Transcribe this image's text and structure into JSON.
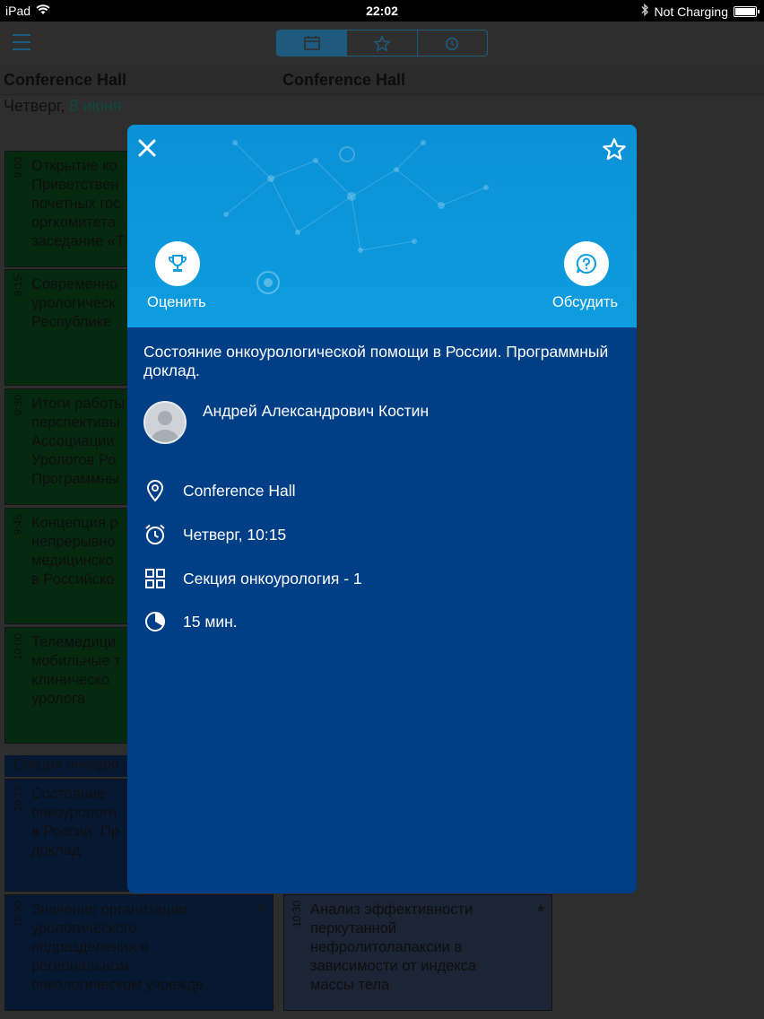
{
  "status_bar": {
    "device": "iPad",
    "time": "22:02",
    "charging": "Not Charging"
  },
  "navbar": {
    "tabs": [
      "calendar-icon",
      "star-icon",
      "alarm-icon"
    ]
  },
  "background": {
    "hall_left": "Conference Hall",
    "hall_right": "Conference Hall",
    "date_prefix": "Четверг,",
    "date_day": "8 июня",
    "cards": [
      {
        "time": "9:00",
        "text": "Открытие ко\nПриветствен\nпочетных гос\nоргкомитета\nзаседание «Т"
      },
      {
        "time": "9:15",
        "text": "Современно\nурологическ\nРеспублике"
      },
      {
        "time": "9:30",
        "text": "Итоги работы\nперспективы\nАссоциации\nУрологов Ро\nПрограммны"
      },
      {
        "time": "9:45",
        "text": "Концепция р\nнепрерывно\nмедицинско\nв Российско"
      },
      {
        "time": "10:00",
        "text": "Телемедици\nмобильные т\nклиническо\nуролога"
      },
      {
        "time": "10:15",
        "text": "Состояние\nонкоурологи\nв России. Пр\nдоклад."
      },
      {
        "time": "10:30",
        "text": "Значение организации\nурологического\nподразделения в\nрегиональном\nонкологическом учрежде…"
      },
      {
        "time": "10:30",
        "text": "Анализ эффективности\nперкутанной\nнефролитолапаксии в\nзависимости от индекса\nмассы тела"
      }
    ],
    "section_label": "Секция онкоуро"
  },
  "modal": {
    "rate_label": "Оценить",
    "discuss_label": "Обсудить",
    "title": "Состояние онкоурологической помощи в России. Программный доклад.",
    "speaker": "Андрей Александрович Костин",
    "location": "Conference Hall",
    "datetime": "Четверг, 10:15",
    "section": "Секция онкоурология - 1",
    "duration": "15 мин."
  },
  "colors": {
    "modal_header": "#0e9ddf",
    "modal_body": "#003e86",
    "accent": "#1e5a7e"
  }
}
